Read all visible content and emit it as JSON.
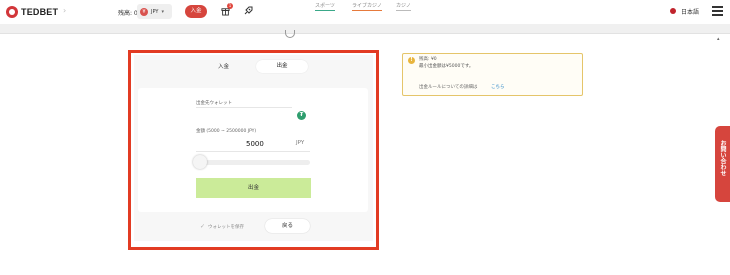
{
  "header": {
    "logo_text": "TEDBET",
    "balance_text": "残高: 0",
    "currency_code": "JPY",
    "currency_icon_letter": "¥",
    "deposit_label": "入金",
    "gift_badge": "1",
    "language": "日本語"
  },
  "nav": {
    "tabs": [
      {
        "label": "スポーツ"
      },
      {
        "label": "ライブカジノ"
      },
      {
        "label": "カジノ"
      }
    ]
  },
  "panel": {
    "tab_deposit": "入金",
    "tab_withdraw": "出金",
    "wallet_label": "出金先ウォレット",
    "wallet_icon_letter": "₮",
    "amount_label": "金額 (5000 ~ 2500000 JPY)",
    "amount_value": "5000",
    "amount_unit": "JPY",
    "slider_value": 0,
    "withdraw_button": "出金",
    "save_wallet_label": "ウォレットを保存",
    "back_button": "戻る"
  },
  "info": {
    "line1": "残高: ¥0",
    "line2": "最小出金額は¥5000です。",
    "rule_text": "出金ルールについての詳細は",
    "rule_link": "こちら"
  },
  "contact": {
    "label": "お問い合わせ"
  },
  "colors": {
    "brand_red": "#d6453d",
    "highlight_red": "#e23b23",
    "withdraw_green": "#cbeb99",
    "tether_green": "#2f9e6e",
    "info_border": "#e5c56a"
  }
}
